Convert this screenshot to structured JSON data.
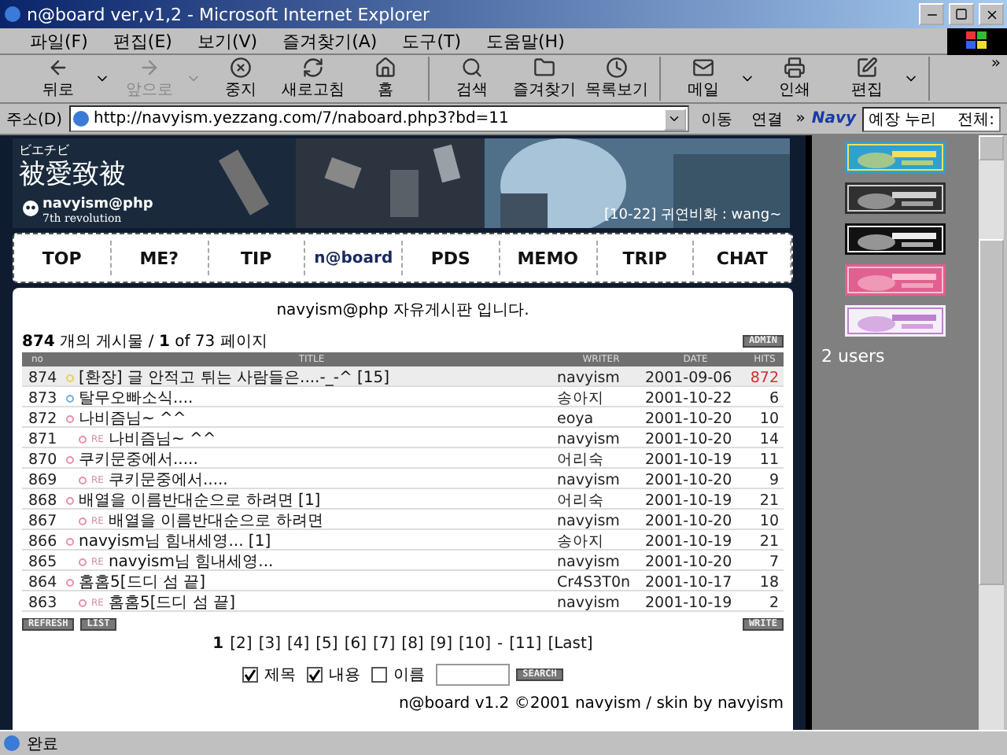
{
  "window": {
    "title": "n@board ver,v1,2 - Microsoft Internet Explorer"
  },
  "menu": [
    "파일(F)",
    "편집(E)",
    "보기(V)",
    "즐겨찾기(A)",
    "도구(T)",
    "도움말(H)"
  ],
  "toolbar": [
    [
      {
        "label": "뒤로",
        "dropdown": true,
        "disabled": false
      },
      {
        "label": "앞으로",
        "dropdown": true,
        "disabled": true
      },
      {
        "label": "중지",
        "dropdown": false,
        "disabled": false
      },
      {
        "label": "새로고침",
        "dropdown": false,
        "disabled": false
      },
      {
        "label": "홈",
        "dropdown": false,
        "disabled": false
      }
    ],
    [
      {
        "label": "검색",
        "dropdown": false,
        "disabled": false
      },
      {
        "label": "즐겨찾기",
        "dropdown": false,
        "disabled": false
      },
      {
        "label": "목록보기",
        "dropdown": false,
        "disabled": false
      }
    ],
    [
      {
        "label": "메일",
        "dropdown": true,
        "disabled": false
      },
      {
        "label": "인쇄",
        "dropdown": false,
        "disabled": false
      },
      {
        "label": "편집",
        "dropdown": true,
        "disabled": false
      }
    ]
  ],
  "toolbar_more": "»",
  "address": {
    "label": "주소(D)",
    "url": "http://navyism.yezzang.com/7/naboard.php3?bd=11",
    "go": "이동",
    "links": "연결",
    "more": "»",
    "navy_logo": "Navy",
    "search_value": "예장 누리",
    "scope": "전체:"
  },
  "header": {
    "kana": "ビエチビ",
    "title": "被愛致被",
    "site": "navyism@php",
    "subtitle": "7th revolution",
    "notice": "[10-22] 귀연비화 : wang~"
  },
  "nav": [
    {
      "label": "TOP",
      "selected": false
    },
    {
      "label": "ME?",
      "selected": false
    },
    {
      "label": "TIP",
      "selected": false
    },
    {
      "label": "n@board",
      "selected": true
    },
    {
      "label": "PDS",
      "selected": false
    },
    {
      "label": "MEMO",
      "selected": false
    },
    {
      "label": "TRIP",
      "selected": false
    },
    {
      "label": "CHAT",
      "selected": false
    }
  ],
  "board": {
    "heading": "navyism@php 자유게시판 입니다.",
    "total": "874",
    "count_text": " 개의 게시물 / ",
    "page": "1",
    "page_text": " of 73 페이지",
    "admin_button": "ADMIN",
    "columns": [
      "no",
      "TITLE",
      "WRITER",
      "DATE",
      "HITS"
    ],
    "rows": [
      {
        "no": "874",
        "kind": "post",
        "color": "#e8d060",
        "title": "[환장] 글 안적고 튀는 사람들은....-_-^ [15]",
        "writer": "navyism",
        "date": "2001-09-06",
        "hits": "872",
        "notice": true
      },
      {
        "no": "873",
        "kind": "post",
        "color": "#70b0e0",
        "title": "탈무오빠소식....",
        "writer": "송아지",
        "date": "2001-10-22",
        "hits": "6",
        "notice": false
      },
      {
        "no": "872",
        "kind": "post",
        "color": "#e890b0",
        "title": "나비즘님~ ^^",
        "writer": "eoya",
        "date": "2001-10-20",
        "hits": "10",
        "notice": false
      },
      {
        "no": "871",
        "kind": "reply",
        "color": "#e890b0",
        "mark": "RE",
        "title": "나비즘님~ ^^",
        "writer": "navyism",
        "date": "2001-10-20",
        "hits": "14",
        "notice": false
      },
      {
        "no": "870",
        "kind": "post",
        "color": "#e890b0",
        "title": "쿠키문중에서.....",
        "writer": "어리숙",
        "date": "2001-10-19",
        "hits": "11",
        "notice": false
      },
      {
        "no": "869",
        "kind": "reply",
        "color": "#e890b0",
        "mark": "RE",
        "title": "쿠키문중에서.....",
        "writer": "navyism",
        "date": "2001-10-20",
        "hits": "9",
        "notice": false
      },
      {
        "no": "868",
        "kind": "post",
        "color": "#e890b0",
        "title": "배열을 이름반대순으로 하려면 [1]",
        "writer": "어리숙",
        "date": "2001-10-19",
        "hits": "21",
        "notice": false
      },
      {
        "no": "867",
        "kind": "reply",
        "color": "#e890b0",
        "mark": "RE",
        "title": "배열을 이름반대순으로 하려면",
        "writer": "navyism",
        "date": "2001-10-20",
        "hits": "10",
        "notice": false
      },
      {
        "no": "866",
        "kind": "post",
        "color": "#e890b0",
        "title": "navyism님 힘내세영... [1]",
        "writer": "송아지",
        "date": "2001-10-19",
        "hits": "21",
        "notice": false
      },
      {
        "no": "865",
        "kind": "reply",
        "color": "#e890b0",
        "mark": "RE",
        "title": "navyism님 힘내세영...",
        "writer": "navyism",
        "date": "2001-10-20",
        "hits": "7",
        "notice": false
      },
      {
        "no": "864",
        "kind": "post",
        "color": "#e890b0",
        "title": "홈홈5[드디 섬 끝]",
        "writer": "Cr4S3T0n",
        "date": "2001-10-17",
        "hits": "18",
        "notice": false
      },
      {
        "no": "863",
        "kind": "reply",
        "color": "#e890b0",
        "mark": "RE",
        "title": "홈홈5[드디 섬 끝]",
        "writer": "navyism",
        "date": "2001-10-19",
        "hits": "2",
        "notice": false
      }
    ],
    "left_buttons": [
      "REFRESH",
      "LIST"
    ],
    "write_button": "WRITE",
    "pages": [
      {
        "label": "1",
        "selected": true
      },
      {
        "label": "[2]",
        "selected": false
      },
      {
        "label": "[3]",
        "selected": false
      },
      {
        "label": "[4]",
        "selected": false
      },
      {
        "label": "[5]",
        "selected": false
      },
      {
        "label": "[6]",
        "selected": false
      },
      {
        "label": "[7]",
        "selected": false
      },
      {
        "label": "[8]",
        "selected": false
      },
      {
        "label": "[9]",
        "selected": false
      },
      {
        "label": "[10]",
        "selected": false
      },
      {
        "label": "-",
        "selected": false
      },
      {
        "label": "[11]",
        "selected": false
      },
      {
        "label": "[Last]",
        "selected": false
      }
    ],
    "search_options": [
      {
        "label": "제목",
        "checked": true
      },
      {
        "label": "내용",
        "checked": true
      },
      {
        "label": "이름",
        "checked": false
      }
    ],
    "search_button": "SEARCH",
    "footer": "n@board v1.2 ©2001 navyism / skin by navyism"
  },
  "sidebar": {
    "users": "2 users"
  },
  "status": {
    "text": "완료"
  }
}
